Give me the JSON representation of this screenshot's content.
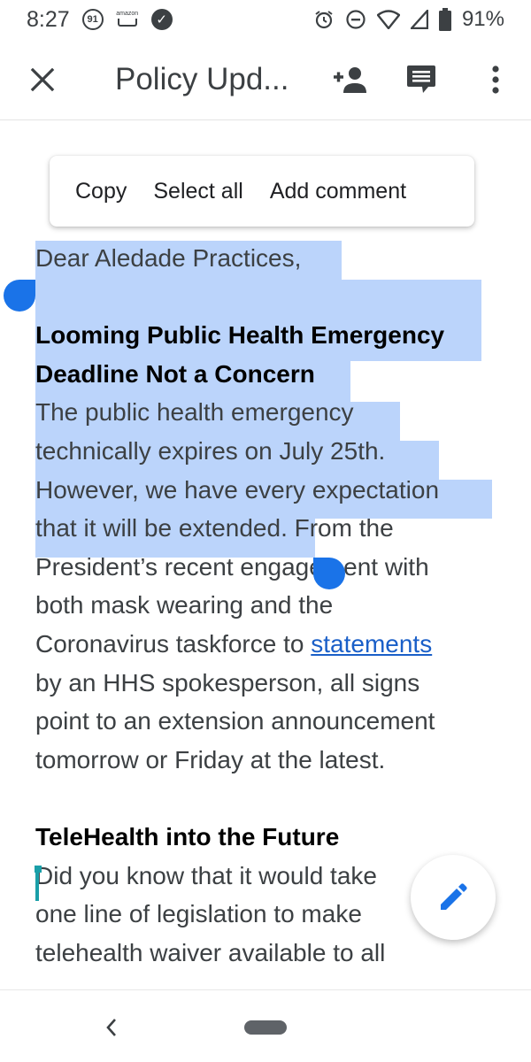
{
  "status_bar": {
    "time": "8:27",
    "notification_count": "91",
    "amazon_label": "amazon",
    "battery": "91%"
  },
  "app_bar": {
    "title": "Policy Upd..."
  },
  "context_menu": {
    "items": [
      "Copy",
      "Select all",
      "Add comment"
    ]
  },
  "document": {
    "greeting": "Dear Aledade Practices,",
    "heading1_line1": "Looming Public Health Emergency",
    "heading1_line2": "Deadline Not a Concern",
    "para1": {
      "line1": "The public health emergency",
      "line2": "technically expires on July 25th.",
      "line3": "However, we have every expectation",
      "line4_selected": "that it will be extended",
      "line4_rest": ". From the",
      "line5": "President’s recent engagement with",
      "line6": "both mask wearing and the",
      "line7_pre": "Coronavirus taskforce to ",
      "line7_link": "statements",
      "line8": "by an HHS spokesperson, all signs",
      "line9": "point to an extension announcement",
      "line10": "tomorrow or Friday at the latest."
    },
    "heading2": "TeleHealth into the Future",
    "para2": {
      "line1": "Did you know that it would take",
      "line2": "one line of legislation to make",
      "line3": "telehealth waiver available to all"
    }
  },
  "colors": {
    "selection": "#bbd4fb",
    "handle": "#1a73e8",
    "link": "#1a5fc8",
    "fab_icon": "#1a73e8"
  }
}
